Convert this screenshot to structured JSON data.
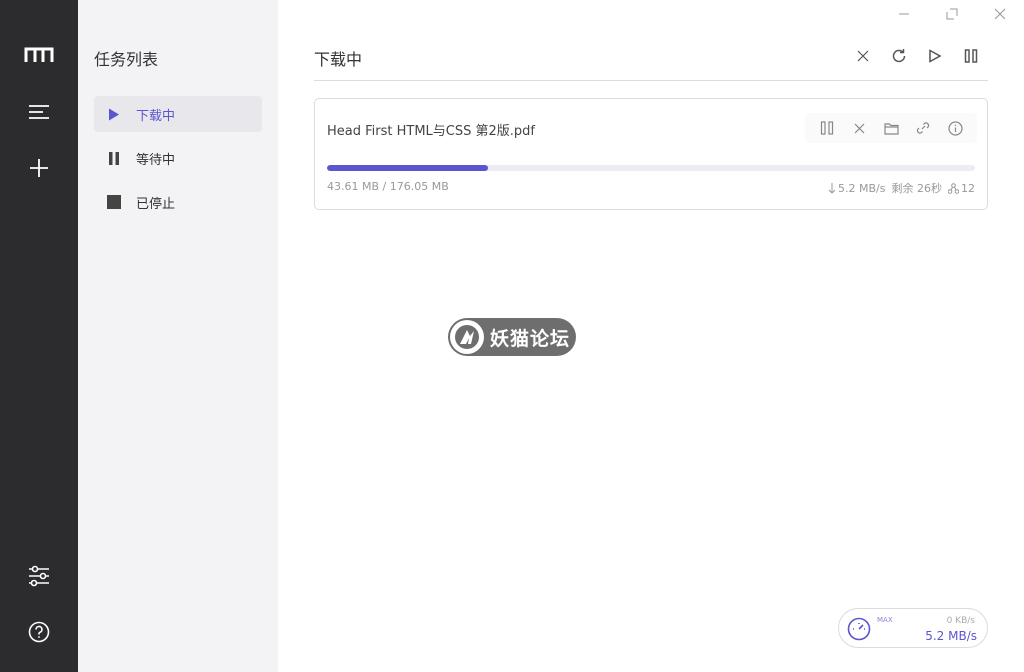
{
  "rail": {
    "items": [
      {
        "name": "logo",
        "icon": "logo-icon"
      },
      {
        "name": "task-list",
        "icon": "menu-icon"
      },
      {
        "name": "new-task",
        "icon": "plus-icon"
      },
      {
        "name": "preferences",
        "icon": "sliders-icon"
      },
      {
        "name": "about",
        "icon": "help-icon"
      }
    ]
  },
  "taskpanel": {
    "title": "任务列表",
    "items": [
      {
        "label": "下载中",
        "icon": "play-icon",
        "active": true
      },
      {
        "label": "等待中",
        "icon": "pause-icon",
        "active": false
      },
      {
        "label": "已停止",
        "icon": "stop-icon",
        "active": false
      }
    ]
  },
  "window": {
    "controls": [
      "minimize-icon",
      "maximize-icon",
      "close-icon"
    ]
  },
  "main": {
    "title": "下载中",
    "toolbar": [
      "close-icon",
      "refresh-icon",
      "play-icon",
      "pause-icon"
    ]
  },
  "task": {
    "name": "Head First HTML与CSS 第2版.pdf",
    "size_text": "43.61 MB / 176.05 MB",
    "progress": 0.248,
    "speed": "5.2 MB/s",
    "remaining": "剩余 26秒",
    "connections": "12",
    "actions": [
      "pause-icon",
      "close-icon",
      "folder-icon",
      "link-icon",
      "info-icon"
    ]
  },
  "watermark": {
    "text": "妖猫论坛"
  },
  "speed_widget": {
    "max_label": "MAX",
    "upload": "0 KB/s",
    "download": "5.2 MB/s"
  },
  "colors": {
    "accent": "#5b55cf",
    "rail_bg": "#2c2c2e",
    "panel_bg": "#f3f3f5"
  }
}
